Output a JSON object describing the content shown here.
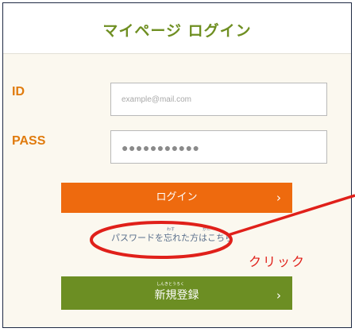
{
  "page": {
    "title": "マイページ ログイン"
  },
  "form": {
    "id_label": "ID",
    "id_placeholder": "example@mail.com",
    "pass_label": "PASS",
    "pass_value": "●●●●●●●●●●●"
  },
  "buttons": {
    "login_label": "ログイン",
    "register_label": "新規登録",
    "register_ruby": "しんきとうろく",
    "chevron": "›"
  },
  "links": {
    "forgot_password": "パスワードを忘れた方はこちら",
    "ruby_wasu": "わす",
    "ruby_kata": "かた"
  },
  "annotation": {
    "text": "クリック",
    "color": "#e0201a"
  },
  "colors": {
    "title_green": "#6f8f22",
    "label_orange": "#e07b0e",
    "login_orange": "#ee6a0e",
    "register_green": "#6c8e23"
  }
}
